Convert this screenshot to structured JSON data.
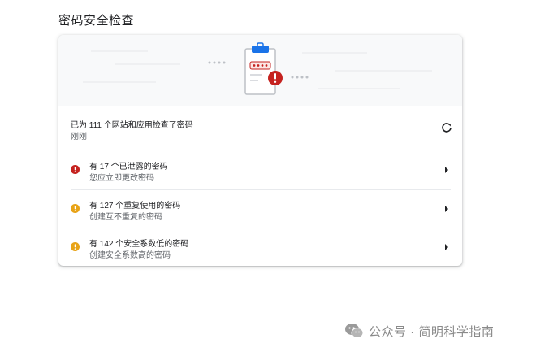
{
  "page": {
    "title": "密码安全检查"
  },
  "summary": {
    "main_text": "已为 111 个网站和应用检查了密码",
    "sub_text": "刚刚",
    "refresh_icon": "refresh-icon"
  },
  "issues": [
    {
      "title": "有 17 个已泄露的密码",
      "subtitle": "您应立即更改密码",
      "severity_color": "#c5221f",
      "icon": "error-icon"
    },
    {
      "title": "有 127 个重复使用的密码",
      "subtitle": "创建互不重复的密码",
      "severity_color": "#e8a317",
      "icon": "warning-icon"
    },
    {
      "title": "有 142 个安全系数低的密码",
      "subtitle": "创建安全系数高的密码",
      "severity_color": "#e8a317",
      "icon": "warning-icon"
    }
  ],
  "colors": {
    "accent_blue": "#1a73e8",
    "alert_red": "#c5221f",
    "warning_yellow": "#e8a317"
  },
  "watermark": {
    "text": "公众号 · 简明科学指南"
  }
}
